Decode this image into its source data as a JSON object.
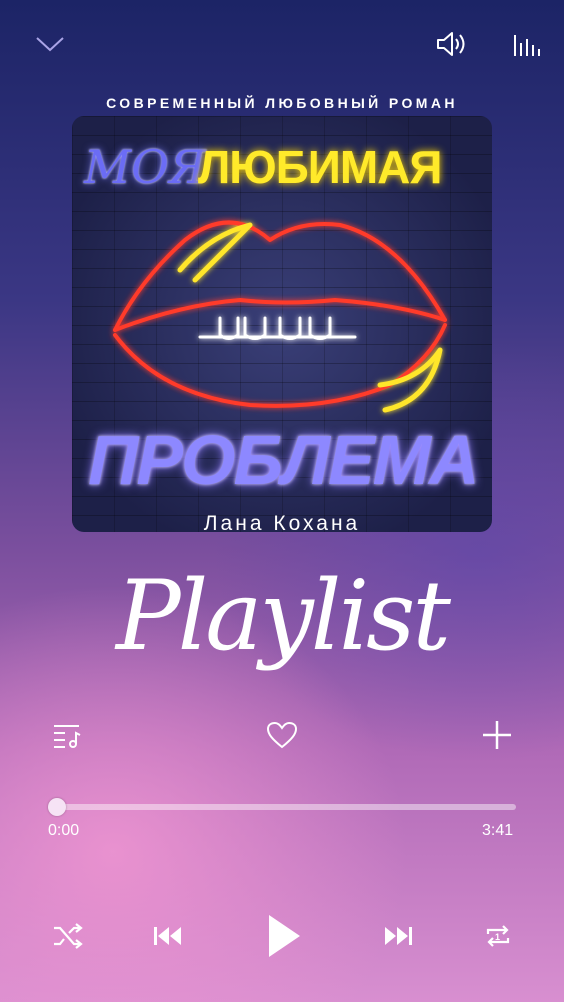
{
  "header": {
    "collapse_icon": "chevron-down-icon",
    "volume_icon": "volume-icon",
    "equalizer_icon": "equalizer-icon"
  },
  "cover": {
    "genre": "СОВРЕМЕННЫЙ ЛЮБОВНЫЙ РОМАН",
    "title_part1": "МОЯ",
    "title_part2": "ЛЮБИМАЯ",
    "title_part3": "ПРОБЛЕМА",
    "author": "Лана Кохана"
  },
  "overlay_title": "Playlist",
  "actions": {
    "queue_icon": "playlist-icon",
    "favorite_icon": "heart-icon",
    "add_icon": "plus-icon"
  },
  "progress": {
    "current": "0:00",
    "total": "3:41",
    "fraction": 0.0
  },
  "controls": {
    "shuffle_icon": "shuffle-icon",
    "prev_icon": "previous-icon",
    "play_icon": "play-icon",
    "next_icon": "next-icon",
    "repeat_icon": "repeat-one-icon"
  },
  "colors": {
    "accent_yellow": "#ffea2a",
    "accent_violet": "#8d88ff",
    "neon_red": "#ff3a2a"
  }
}
